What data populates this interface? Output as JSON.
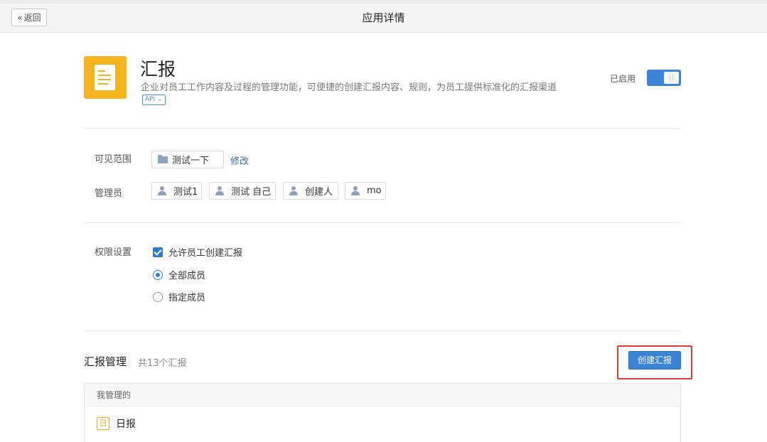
{
  "header": {
    "back_label": "返回",
    "back_glyph": "«",
    "title": "应用详情"
  },
  "app": {
    "name": "汇报",
    "description": "企业对员工工作内容及过程的管理功能，可便捷的创建汇报内容、规则，为员工提供标准化的汇报渠道",
    "api_badge": "API ⌄",
    "icon_color": "#f5b41e",
    "enabled_label": "已启用",
    "enabled": true,
    "toggle_color": "#3d84d6"
  },
  "scope": {
    "label": "可见范围",
    "value": "测试一下",
    "edit_label": "修改"
  },
  "admins": {
    "label": "管理员",
    "items": [
      "测试1",
      "测试 自己",
      "创建人",
      "mo"
    ]
  },
  "permissions": {
    "label": "权限设置",
    "checkbox_label": "允许员工创建汇报",
    "checkbox_checked": true,
    "options": [
      {
        "label": "全部成员",
        "selected": true
      },
      {
        "label": "指定成员",
        "selected": false
      }
    ]
  },
  "reports": {
    "title": "汇报管理",
    "count_text": "共13个汇报",
    "create_label": "创建汇报",
    "group_header": "我管理的",
    "items": [
      {
        "icon_text": "日",
        "label": "日报"
      }
    ]
  },
  "colors": {
    "accent": "#3a83d3",
    "highlight_box": "#e53935",
    "report_icon": "#f0a21b"
  }
}
